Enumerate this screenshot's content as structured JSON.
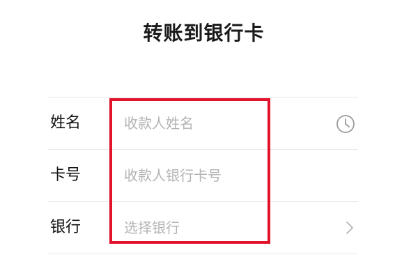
{
  "header": {
    "title": "转账到银行卡"
  },
  "form": {
    "name_row": {
      "label": "姓名",
      "placeholder": "收款人姓名",
      "icon": "clock-history-icon"
    },
    "card_row": {
      "label": "卡号",
      "placeholder": "收款人银行卡号"
    },
    "bank_row": {
      "label": "银行",
      "placeholder": "选择银行",
      "icon": "chevron-right-icon"
    }
  },
  "colors": {
    "highlight_border": "#e2122a",
    "placeholder": "#b3b3b3",
    "divider": "#e8e8e8"
  }
}
